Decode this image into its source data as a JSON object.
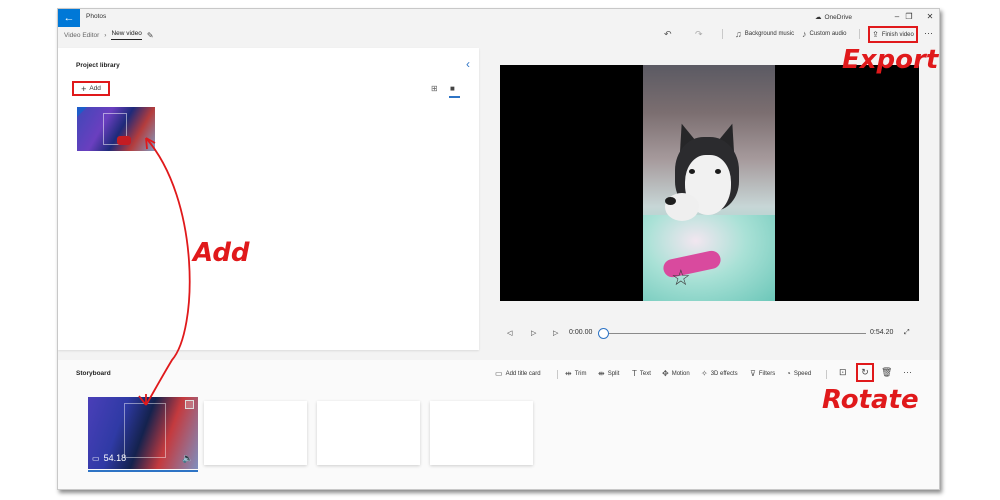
{
  "titlebar": {
    "back_icon": "back-arrow-icon",
    "app_title": "Photos",
    "onedrive": "OneDrive",
    "minimize": "–",
    "maximize": "❐",
    "close": "✕"
  },
  "breadcrumb": {
    "parent": "Video Editor",
    "current": "New video",
    "rename_icon": "pencil-icon"
  },
  "toolbar": {
    "undo": "↶",
    "redo": "↷",
    "background_music": "Background music",
    "custom_audio": "Custom audio",
    "finish_video": "Finish video",
    "more": "···"
  },
  "library": {
    "title": "Project library",
    "add_label": "Add",
    "collapse_icon": "chevron-left-icon",
    "view_grid_icon": "grid-view-icon",
    "view_list_icon": "large-tiles-icon"
  },
  "playback": {
    "current_time": "0:00.00",
    "total_time": "0:54.20",
    "position_fraction": 0
  },
  "storyboard": {
    "title": "Storyboard",
    "tools": [
      {
        "label": "Add title card",
        "icon": "title-card-icon"
      },
      {
        "label": "Trim",
        "icon": "trim-icon"
      },
      {
        "label": "Split",
        "icon": "split-icon"
      },
      {
        "label": "Text",
        "icon": "text-icon"
      },
      {
        "label": "Motion",
        "icon": "motion-icon"
      },
      {
        "label": "3D effects",
        "icon": "3d-effects-icon"
      },
      {
        "label": "Filters",
        "icon": "filters-icon"
      },
      {
        "label": "Speed",
        "icon": "speed-icon"
      }
    ],
    "clip_duration": "54.18"
  },
  "annotations": {
    "export": "Export",
    "add": "Add",
    "rotate": "Rotate"
  },
  "colors": {
    "accent": "#0078d7",
    "highlight_red": "#e0191b"
  }
}
